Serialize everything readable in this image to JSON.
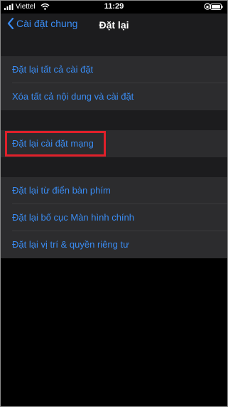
{
  "status_bar": {
    "carrier": "Viettel",
    "time": "11:29"
  },
  "nav": {
    "back_label": "Cài đặt chung",
    "title": "Đặt lại"
  },
  "groups": [
    {
      "items": [
        "Đặt lại tất cả cài đặt",
        "Xóa tất cả nội dung và cài đặt"
      ]
    },
    {
      "items": [
        "Đặt lại cài đặt mạng"
      ]
    },
    {
      "items": [
        "Đặt lại từ điển bàn phím",
        "Đặt lại bố cục Màn hình chính",
        "Đặt lại vị trí & quyền riêng tư"
      ]
    }
  ],
  "colors": {
    "accent": "#3a8cf3",
    "highlight_box": "#e0202a"
  }
}
